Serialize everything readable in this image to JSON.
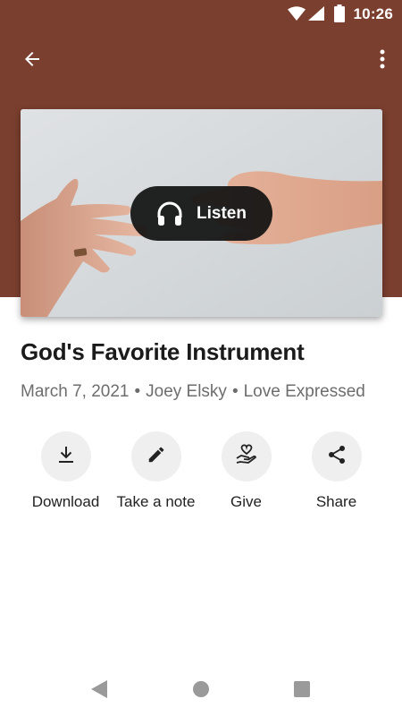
{
  "status_bar": {
    "time": "10:26",
    "icons": [
      "wifi-icon",
      "signal-icon",
      "battery-icon"
    ]
  },
  "app_bar": {
    "back_icon": "arrow-back-icon",
    "menu_icon": "more-vertical-icon"
  },
  "colors": {
    "header_background": "#7a3f2e",
    "listen_background": "#121212",
    "action_circle": "#efefef",
    "title_text": "#1b1b1b",
    "meta_text": "#6d6d6d"
  },
  "hero": {
    "image_description_icon": "hands-reaching-image",
    "listen_label": "Listen",
    "listen_icon": "headphones-icon"
  },
  "sermon": {
    "title": "God's Favorite Instrument",
    "date": "March 7, 2021",
    "speaker": "Joey Elsky",
    "series": "Love Expressed",
    "separator": "•"
  },
  "actions": [
    {
      "label": "Download",
      "icon": "download-icon"
    },
    {
      "label": "Take a note",
      "icon": "pencil-icon"
    },
    {
      "label": "Give",
      "icon": "heart-hand-icon"
    },
    {
      "label": "Share",
      "icon": "share-icon"
    }
  ],
  "nav_bar": {
    "icons": [
      "nav-back-icon",
      "nav-home-icon",
      "nav-recents-icon"
    ]
  }
}
